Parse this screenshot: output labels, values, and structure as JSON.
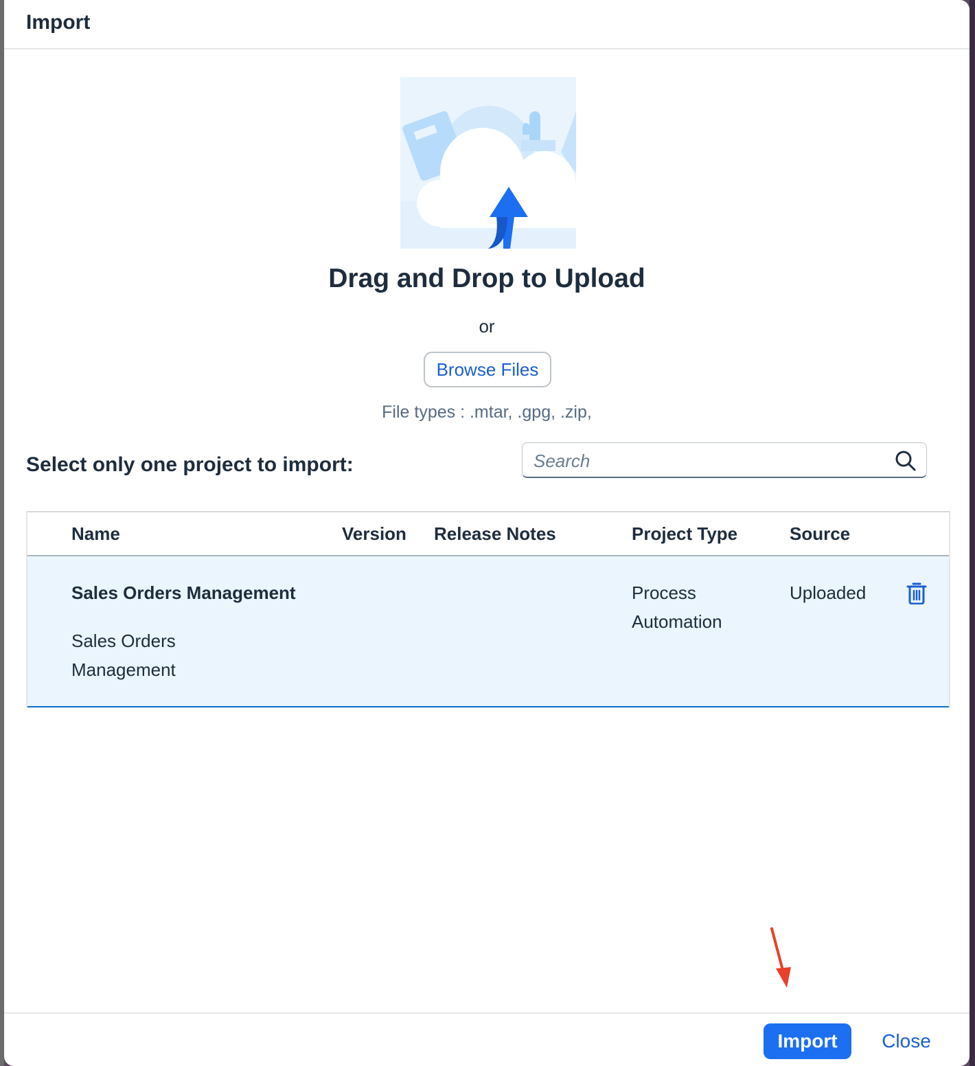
{
  "dialog": {
    "title": "Import"
  },
  "upload": {
    "title": "Drag and Drop to Upload",
    "or_text": "or",
    "browse_label": "Browse Files",
    "file_types": "File types : .mtar, .gpg, .zip,"
  },
  "selection": {
    "label": "Select only one project to import:",
    "search_placeholder": "Search"
  },
  "table": {
    "columns": [
      "Name",
      "Version",
      "Release Notes",
      "Project Type",
      "Source"
    ],
    "rows": [
      {
        "name": "Sales Orders Management",
        "description_line1": "Sales Orders",
        "description_line2": "Management",
        "version": "",
        "release_notes": "",
        "project_type_line1": "Process",
        "project_type_line2": "Automation",
        "source": "Uploaded",
        "action_icon": "delete-icon"
      }
    ]
  },
  "footer": {
    "import_label": "Import",
    "close_label": "Close"
  },
  "colors": {
    "accent": "#1b6ff0",
    "link": "#1b5fd1",
    "selected_row": "#eaf5fd",
    "annotation": "#e8402a"
  }
}
